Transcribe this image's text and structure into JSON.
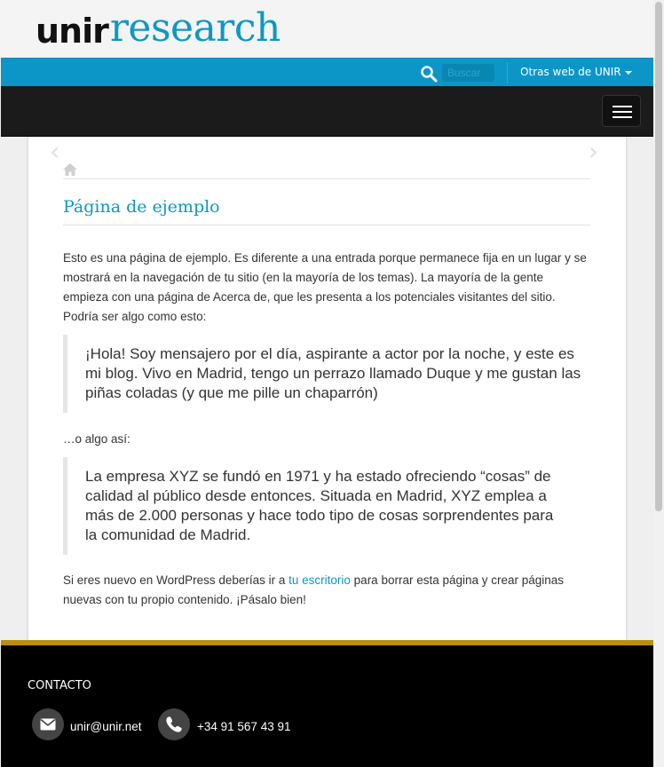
{
  "brand": {
    "logo_part1": "unir",
    "logo_part2": "research",
    "accent": "#0d98c4"
  },
  "topbar": {
    "search_placeholder": "Buscar",
    "other_webs_label": "Otras web de UNIR"
  },
  "content": {
    "page_title": "Página de ejemplo",
    "intro": "Esto es una página de ejemplo. Es diferente a una entrada porque permanece fija en un lugar y se mostrará en la navegación de tu sitio (en la mayoría de los temas). La mayoría de la gente empieza con una página de Acerca de, que les presenta a los potenciales visitantes del sitio. Podría ser algo como esto:",
    "quote1": "¡Hola! Soy mensajero por el día, aspirante a actor por la noche, y este es mi blog. Vivo en Madrid, tengo un perrazo llamado Duque y me gustan las piñas coladas (y que me pille un chaparrón)",
    "middle": "…o algo así:",
    "quote2": "La empresa XYZ se fundó en 1971 y ha estado ofreciendo “cosas” de calidad al público desde entonces. Situada en Madrid, XYZ emplea a más de 2.000 personas y hace todo tipo de cosas sorprendentes para la comunidad de Madrid.",
    "closing_before": "Si eres nuevo en WordPress deberías ir a ",
    "closing_link": "tu escritorio",
    "closing_after": " para borrar esta página y crear páginas nuevas con tu propio contenido. ¡Pásalo bien!"
  },
  "footer": {
    "title": "CONTACTO",
    "email": "unir@unir.net",
    "phone": "+34 91 567 43 91"
  }
}
